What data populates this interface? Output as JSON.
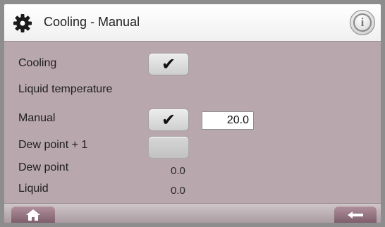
{
  "header": {
    "title": "Cooling - Manual",
    "gear_icon": "gear-icon",
    "info_icon": "info-icon",
    "info_glyph": "i"
  },
  "rows": {
    "cooling": {
      "label": "Cooling",
      "checked": true,
      "check_glyph": "✔"
    },
    "liquid_temperature": {
      "label": "Liquid temperature"
    },
    "manual": {
      "label": "Manual",
      "checked": true,
      "check_glyph": "✔",
      "value": "20.0"
    },
    "dew_point_plus": {
      "label": "Dew point + 1",
      "checked": false
    },
    "dew_point": {
      "label": "Dew point",
      "value": "0.0"
    },
    "liquid": {
      "label": "Liquid",
      "value": "0.0"
    }
  },
  "footer": {
    "home_icon": "home-icon",
    "back_icon": "back-arrow-icon"
  },
  "colors": {
    "panel_background": "#b8a7ad",
    "footer_button": "#8f6f7b"
  }
}
